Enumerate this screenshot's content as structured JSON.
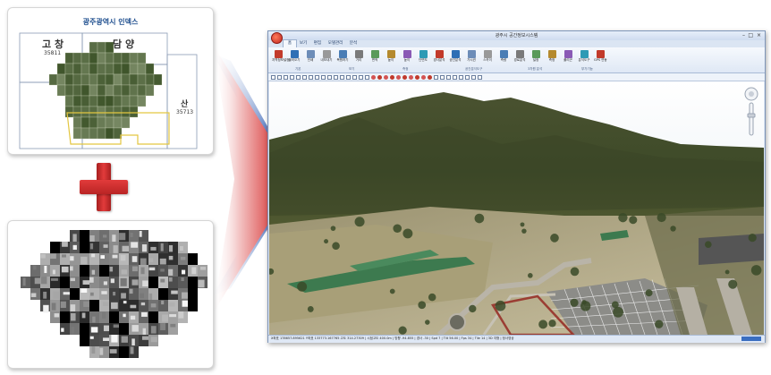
{
  "index_map": {
    "title": "광주광역시 인덱스",
    "sheets": [
      {
        "name": "고 창",
        "number": "35811"
      },
      {
        "name": "담 양",
        "number": ""
      },
      {
        "name": "산",
        "number": "35713"
      }
    ]
  },
  "app": {
    "window_title": "광주시 공간정보시스템",
    "minimize": "–",
    "maximize": "□",
    "close": "×",
    "menu_tabs": [
      "홈",
      "보기",
      "편집",
      "모델관리",
      "분석"
    ],
    "ribbon_buttons": [
      "지역정보설정",
      "불러오기",
      "인쇄",
      "내보내기",
      "복원하기",
      "거리",
      "면적",
      "높이",
      "높이",
      "단면도",
      "경사분석",
      "공간분석",
      "가시권",
      "스카이",
      "측량",
      "경로분석",
      "설정",
      "측정",
      "폴리곤",
      "분석도구",
      "GPS 연동"
    ],
    "ribbon_groups": [
      "기본",
      "보기",
      "측정",
      "공간분석도구",
      "3차원 분석",
      "부가기능"
    ],
    "status_text": "X좌표 178657.895621 Y좌표 133773.167765 고도 314.27309 | 시점고도 400.0m | 방향 -94.855 | 경사 -30 | Spd 7 | Tilt 56.00 | Fps 34 | Tile 14 | 3D 지형 | 정사영상"
  },
  "colors": {
    "accent_red": "#d62a2a",
    "window_frame": "#7e95b8",
    "status_blue": "#3a6ec1"
  }
}
